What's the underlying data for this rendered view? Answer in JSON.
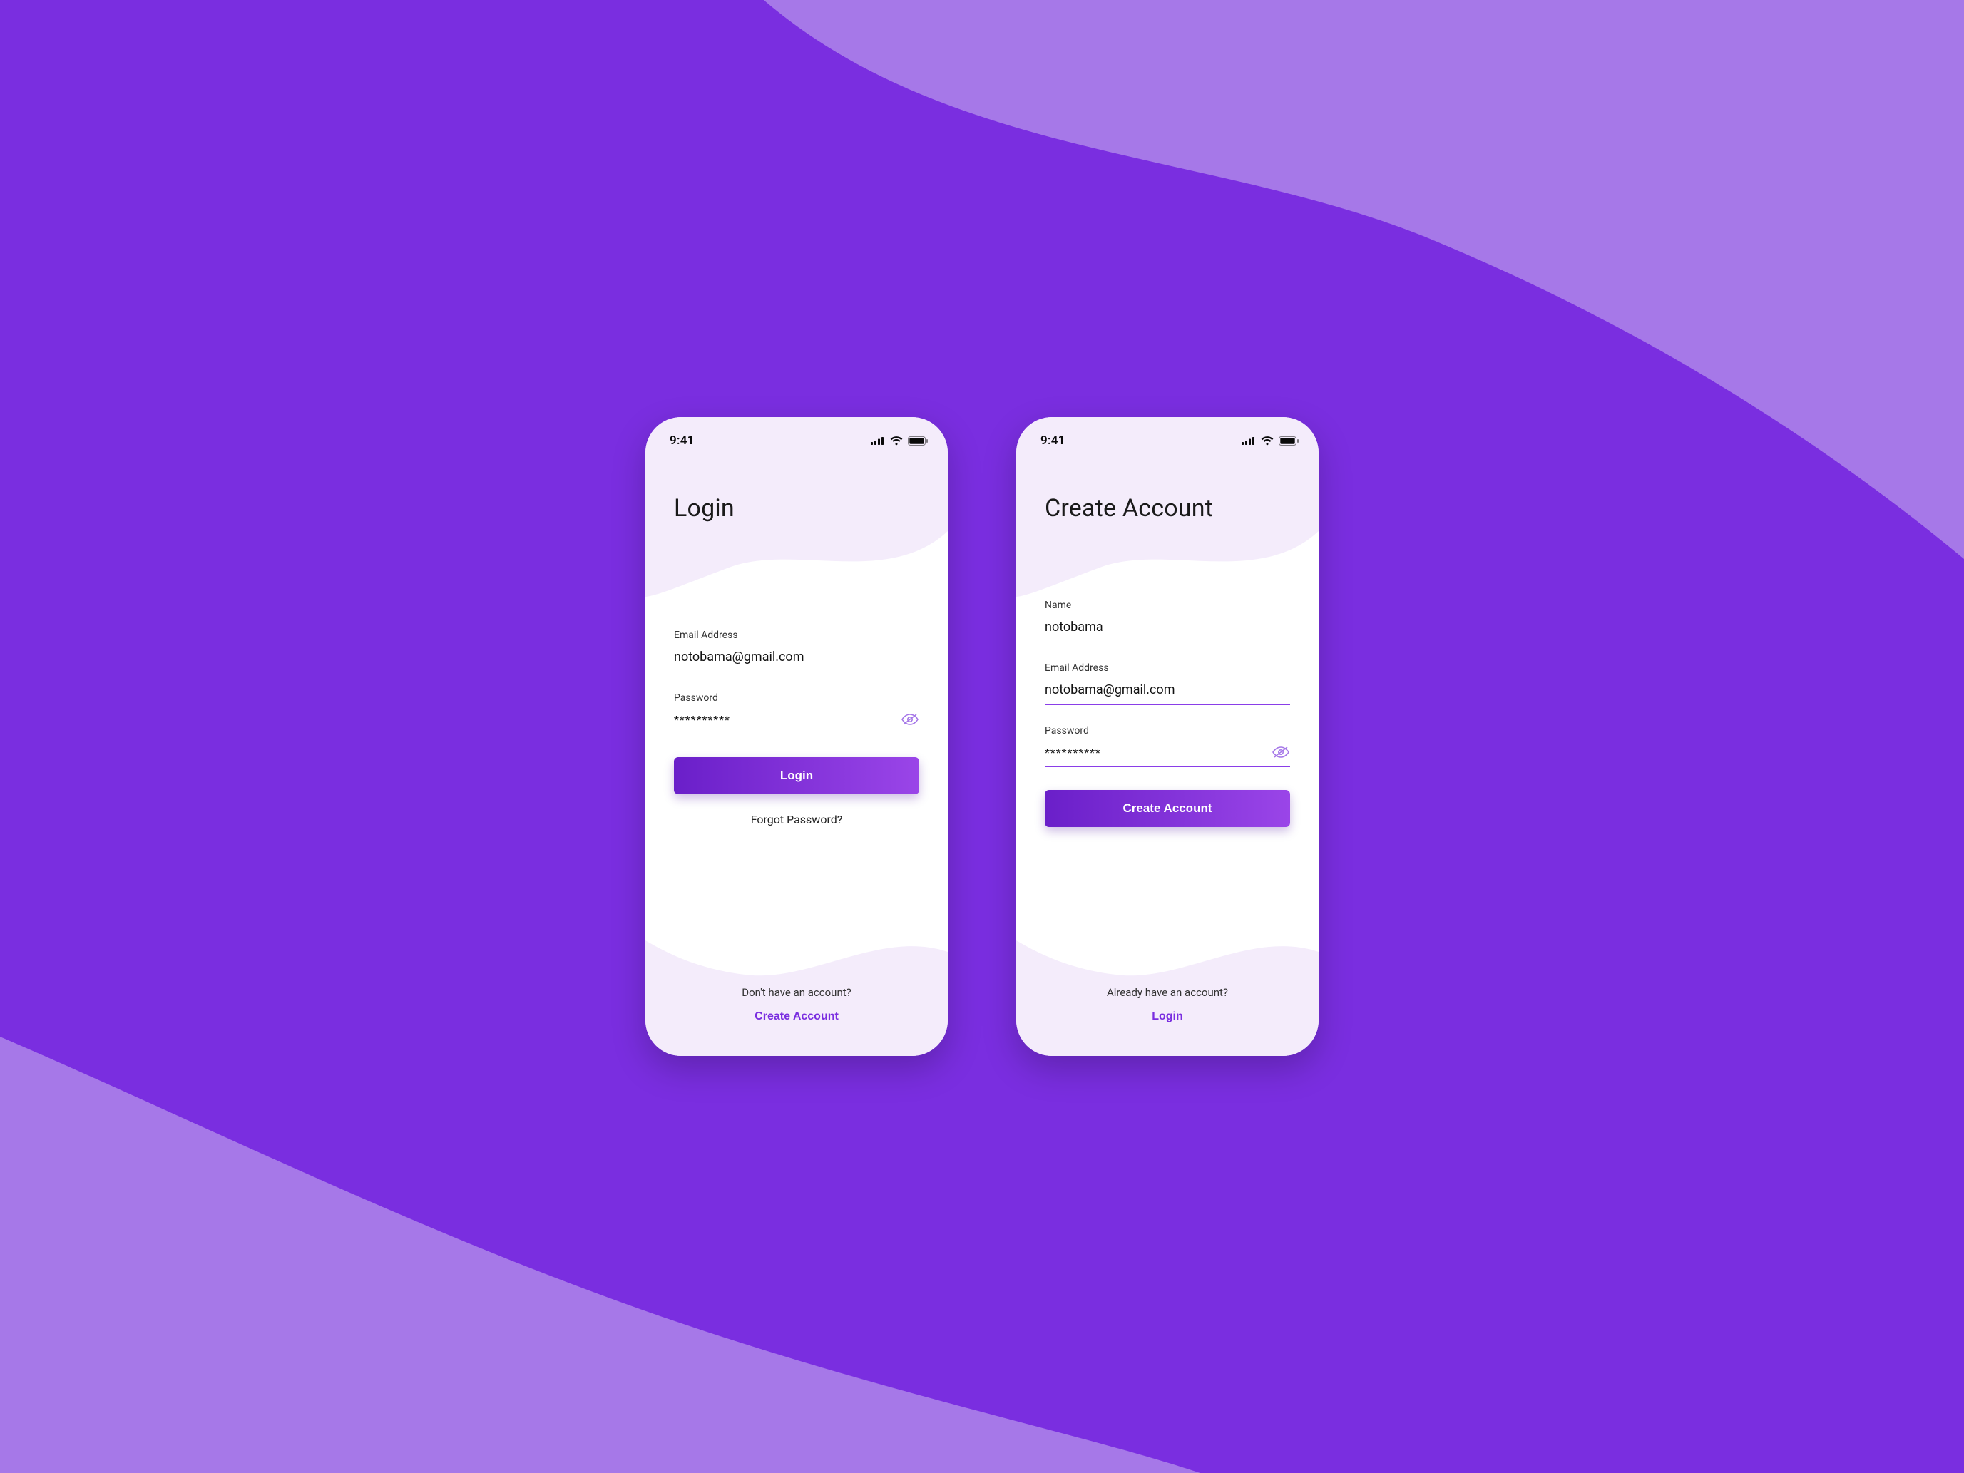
{
  "status": {
    "time": "9:41"
  },
  "colors": {
    "bg_dark": "#7a2ee0",
    "bg_light": "#a678e8",
    "header_wave": "#f4ecfb",
    "accent": "#8a3ee8"
  },
  "login": {
    "title": "Login",
    "email_label": "Email Address",
    "email_value": "notobama@gmail.com",
    "password_label": "Password",
    "password_masked": "**********",
    "submit_label": "Login",
    "forgot_label": "Forgot Password?",
    "footer_prompt": "Don't have an account?",
    "footer_link": "Create Account"
  },
  "signup": {
    "title": "Create Account",
    "name_label": "Name",
    "name_value": "notobama",
    "email_label": "Email Address",
    "email_value": "notobama@gmail.com",
    "password_label": "Password",
    "password_masked": "**********",
    "submit_label": "Create Account",
    "footer_prompt": "Already have an account?",
    "footer_link": "Login"
  }
}
